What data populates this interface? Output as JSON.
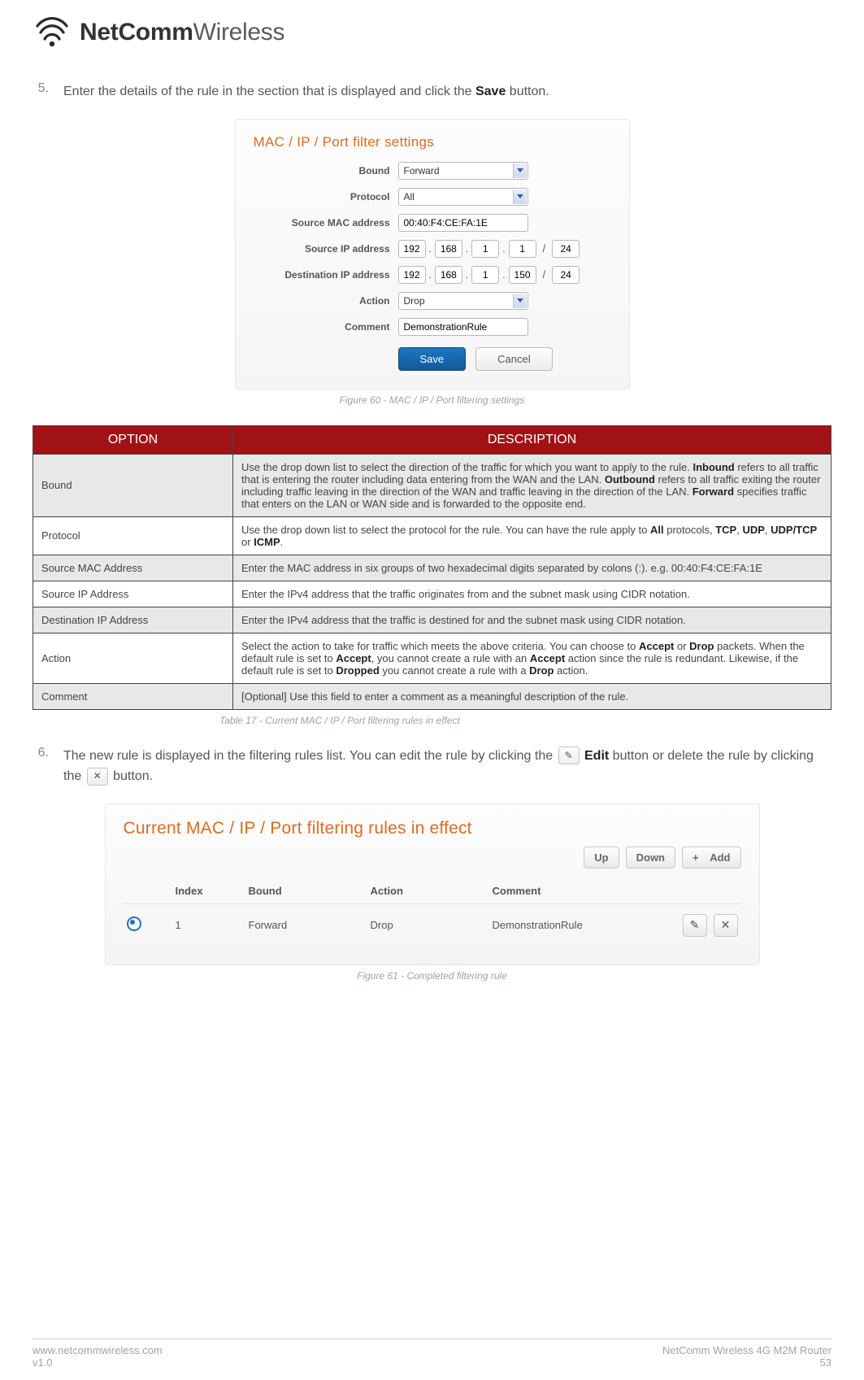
{
  "brand": {
    "strong": "NetComm",
    "light": "Wireless"
  },
  "step5": {
    "num": "5.",
    "pre": "Enter the details of the rule in the section that is displayed and click the ",
    "kw": "Save",
    "post": " button."
  },
  "form": {
    "title": "MAC / IP / Port filter settings",
    "labels": {
      "bound": "Bound",
      "protocol": "Protocol",
      "srcmac": "Source MAC address",
      "srcip": "Source IP address",
      "dstip": "Destination IP address",
      "action": "Action",
      "comment": "Comment"
    },
    "values": {
      "bound": "Forward",
      "protocol": "All",
      "srcmac": "00:40:F4:CE:FA:1E",
      "srcip": [
        "192",
        "168",
        "1",
        "1",
        "24"
      ],
      "dstip": [
        "192",
        "168",
        "1",
        "150",
        "24"
      ],
      "action": "Drop",
      "comment": "DemonstrationRule"
    },
    "buttons": {
      "save": "Save",
      "cancel": "Cancel"
    }
  },
  "fig60": "Figure 60 - MAC / IP / Port filtering settings",
  "table": {
    "head": {
      "option": "OPTION",
      "desc": "DESCRIPTION"
    },
    "rows": [
      {
        "opt": "Bound",
        "desc_parts": [
          "Use the drop down list to select the direction of the traffic for which you want to apply to the rule. ",
          "Inbound",
          " refers to all traffic that is entering the router including data entering from the WAN and the LAN. ",
          "Outbound",
          " refers to all traffic exiting the router including traffic leaving in the direction of the WAN and traffic leaving in the direction of the LAN. ",
          "Forward",
          " specifies traffic that enters on the LAN or WAN side and is forwarded to the opposite end."
        ]
      },
      {
        "opt": "Protocol",
        "desc_parts": [
          "Use the drop down list to select the protocol for the rule. You can have the rule apply to ",
          "All",
          " protocols, ",
          "TCP",
          ", ",
          "UDP",
          ", ",
          "UDP/TCP",
          " or ",
          "ICMP",
          "."
        ]
      },
      {
        "opt": "Source MAC Address",
        "desc_parts": [
          "Enter the MAC address in six groups of two hexadecimal digits separated by colons (:). e.g. 00:40:F4:CE:FA:1E"
        ]
      },
      {
        "opt": "Source IP Address",
        "desc_parts": [
          "Enter the IPv4 address that the traffic originates from and the subnet mask using CIDR notation."
        ]
      },
      {
        "opt": "Destination IP Address",
        "desc_parts": [
          "Enter the IPv4 address that the traffic is destined for and the subnet mask using CIDR notation."
        ]
      },
      {
        "opt": "Action",
        "desc_parts": [
          "Select the action to take for traffic which meets the above criteria. You can choose to ",
          "Accept",
          " or ",
          "Drop",
          " packets. When the default rule is set to ",
          "Accept",
          ", you cannot create a rule with an ",
          "Accept",
          " action since the rule is redundant. Likewise, if the default rule is set to ",
          "Dropped",
          " you cannot create a rule with a ",
          "Drop",
          " action."
        ]
      },
      {
        "opt": "Comment",
        "desc_parts": [
          "[Optional] Use this field to enter a comment as a meaningful description of the rule."
        ]
      }
    ],
    "caption": "Table 17 - Current MAC / IP / Port filtering rules in effect"
  },
  "step6": {
    "num": "6.",
    "a": "The new rule is displayed in the filtering rules list. You can edit the rule by clicking the ",
    "b": " Edit",
    "c": " button or delete the rule by clicking the ",
    "d": " button."
  },
  "rules": {
    "title": "Current MAC / IP / Port filtering rules in effect",
    "toolbar": {
      "up": "Up",
      "down": "Down",
      "add": "Add",
      "plus": "+"
    },
    "head": {
      "index": "Index",
      "bound": "Bound",
      "action": "Action",
      "comment": "Comment"
    },
    "row": {
      "index": "1",
      "bound": "Forward",
      "action": "Drop",
      "comment": "DemonstrationRule"
    }
  },
  "fig61": "Figure 61 - Completed filtering rule",
  "footer": {
    "url": "www.netcommwireless.com",
    "ver": "v1.0",
    "product": "NetComm Wireless 4G M2M Router",
    "page": "53"
  }
}
